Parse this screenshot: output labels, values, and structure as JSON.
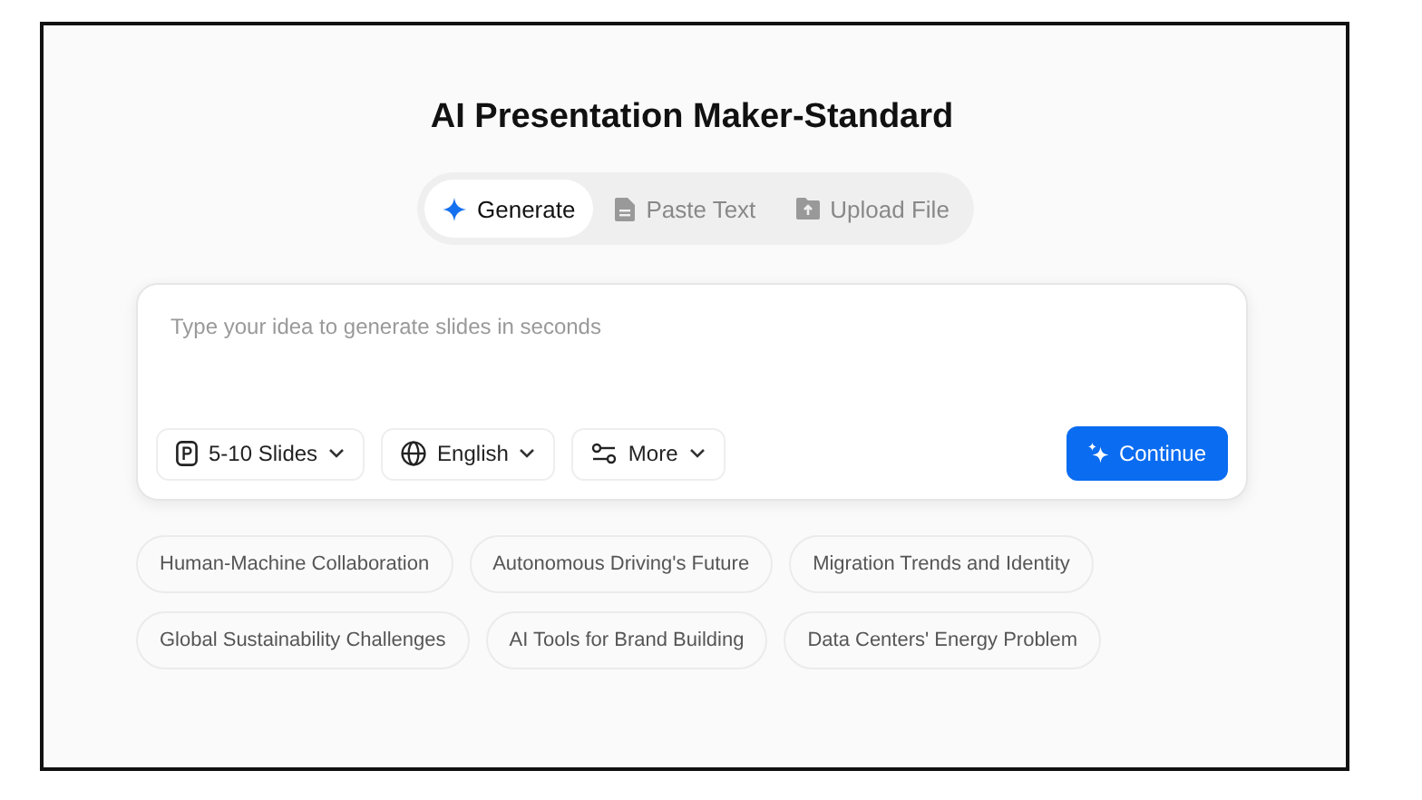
{
  "title": "AI Presentation Maker-Standard",
  "tabs": [
    {
      "label": "Generate",
      "selected": true
    },
    {
      "label": "Paste Text",
      "selected": false
    },
    {
      "label": "Upload File",
      "selected": false
    }
  ],
  "prompt": {
    "placeholder": "Type your idea to generate slides in seconds"
  },
  "options": [
    {
      "label": "5-10 Slides"
    },
    {
      "label": "English"
    },
    {
      "label": "More"
    }
  ],
  "submit": {
    "label": "Continue"
  },
  "suggestion_rows": [
    [
      "Human-Machine Collaboration",
      "Autonomous Driving's Future",
      "Migration Trends and Identity"
    ],
    [
      "Global Sustainability Challenges",
      "AI Tools for Brand Building",
      "Data Centers' Energy Problem"
    ]
  ]
}
